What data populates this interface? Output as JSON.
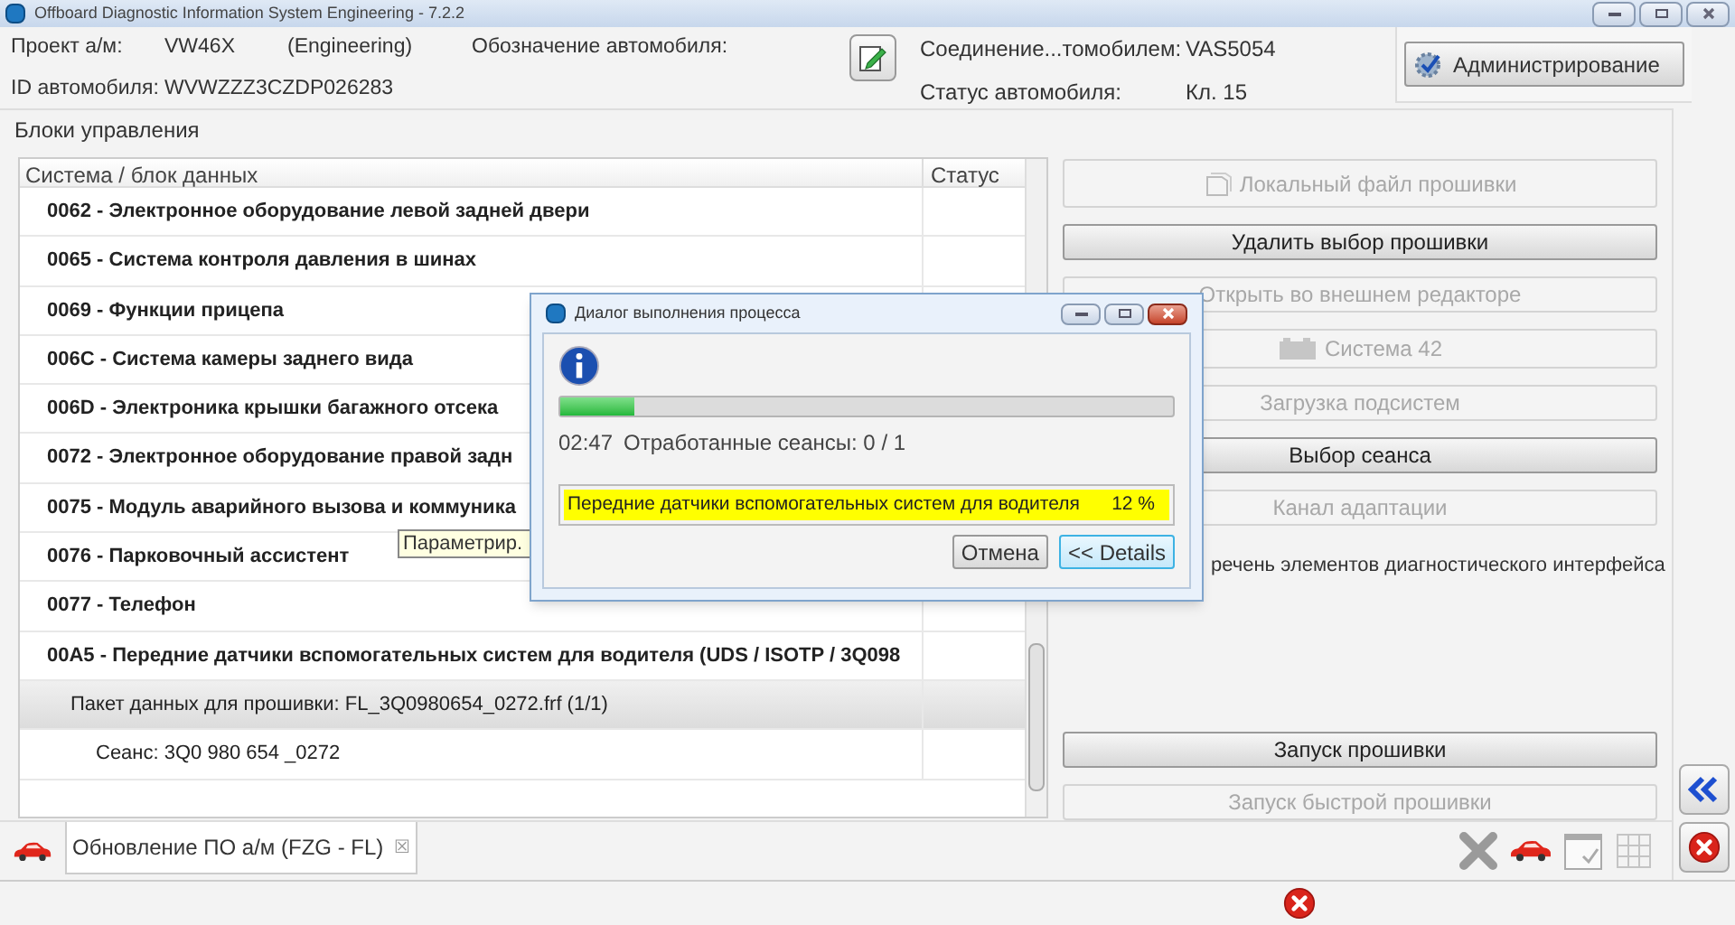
{
  "window": {
    "title": "Offboard Diagnostic Information System Engineering - 7.2.2"
  },
  "header": {
    "fields": [
      {
        "label": "Проект а/м:",
        "value": "VW46X",
        "extra": "(Engineering)"
      },
      {
        "label": "ID автомобиля:",
        "value": "WVWZZZ3CZDP026283"
      }
    ],
    "designation_label": "Обозначение автомобиля:",
    "status_fields": [
      {
        "label": "Соединение...томобилем:",
        "value": "VAS5054"
      },
      {
        "label": "Статус автомобиля:",
        "value": "Кл. 15"
      }
    ],
    "admin_button": "Администрирование"
  },
  "panel_title": "Блоки управления",
  "table": {
    "columns": [
      "Система / блок данных",
      "Статус"
    ],
    "rows": [
      {
        "kind": "module",
        "text": "0062 - Электронное оборудование левой задней двери",
        "selected": false
      },
      {
        "kind": "module",
        "text": "0065 - Система контроля давления в шинах",
        "selected": false
      },
      {
        "kind": "module",
        "text": "0069 - Функции прицепа",
        "selected": false
      },
      {
        "kind": "module",
        "text": "006C - Система камеры заднего вида",
        "selected": false
      },
      {
        "kind": "module",
        "text": "006D - Электроника крышки багажного отсека",
        "selected": false
      },
      {
        "kind": "module",
        "text": "0072 - Электронное оборудование правой задн",
        "selected": false
      },
      {
        "kind": "module",
        "text": "0075 - Модуль аварийного вызова и коммуника",
        "selected": false
      },
      {
        "kind": "module",
        "text": "0076 - Парковочный ассистент",
        "selected": false
      },
      {
        "kind": "module",
        "text": "0077 - Телефон",
        "selected": false
      },
      {
        "kind": "module",
        "text": "00A5 - Передние датчики вспомогательных систем для водителя  (UDS / ISOTP / 3Q098",
        "selected": false
      },
      {
        "kind": "package",
        "text": "Пакет данных для прошивки: FL_3Q0980654_0272.frf (1/1)",
        "selected": true
      },
      {
        "kind": "session",
        "text": "Сеанс: 3Q0 980 654 _0272",
        "selected": false
      }
    ]
  },
  "tooltip": "Параметрир.",
  "actions": [
    {
      "kind": "file-button",
      "label": "Локальный файл прошивки",
      "disabled": true
    },
    {
      "kind": "button",
      "label": "Удалить выбор прошивки",
      "disabled": false
    },
    {
      "kind": "button",
      "label": "Открыть во внешнем редакторе",
      "disabled": true
    },
    {
      "kind": "device-button",
      "label": "Система 42",
      "disabled": true
    },
    {
      "kind": "button",
      "label": "Загрузка подсистем",
      "disabled": true
    },
    {
      "kind": "button",
      "label": "Выбор сеанса",
      "disabled": false
    },
    {
      "kind": "button",
      "label": "Канал адаптации",
      "disabled": true
    },
    {
      "kind": "text",
      "label": "речень элементов диагностического интерфейса"
    },
    {
      "kind": "spacer"
    },
    {
      "kind": "button",
      "label": "Запуск прошивки",
      "disabled": false
    },
    {
      "kind": "button",
      "label": "Запуск быстрой прошивки",
      "disabled": true
    }
  ],
  "tab": {
    "label": "Обновление ПО а/м (FZG - FL)",
    "close": "☒"
  },
  "dialog": {
    "title": "Диалог выполнения процесса",
    "level": 0.12,
    "time": "02:47",
    "sessions": "Отработанные сеансы: 0 / 1",
    "current": "Передние датчики вспомогательных систем для водителя",
    "percent": "12 %",
    "buttons": [
      {
        "label": "Отмена",
        "focused": false
      },
      {
        "label": "<< Details",
        "focused": true
      }
    ]
  }
}
